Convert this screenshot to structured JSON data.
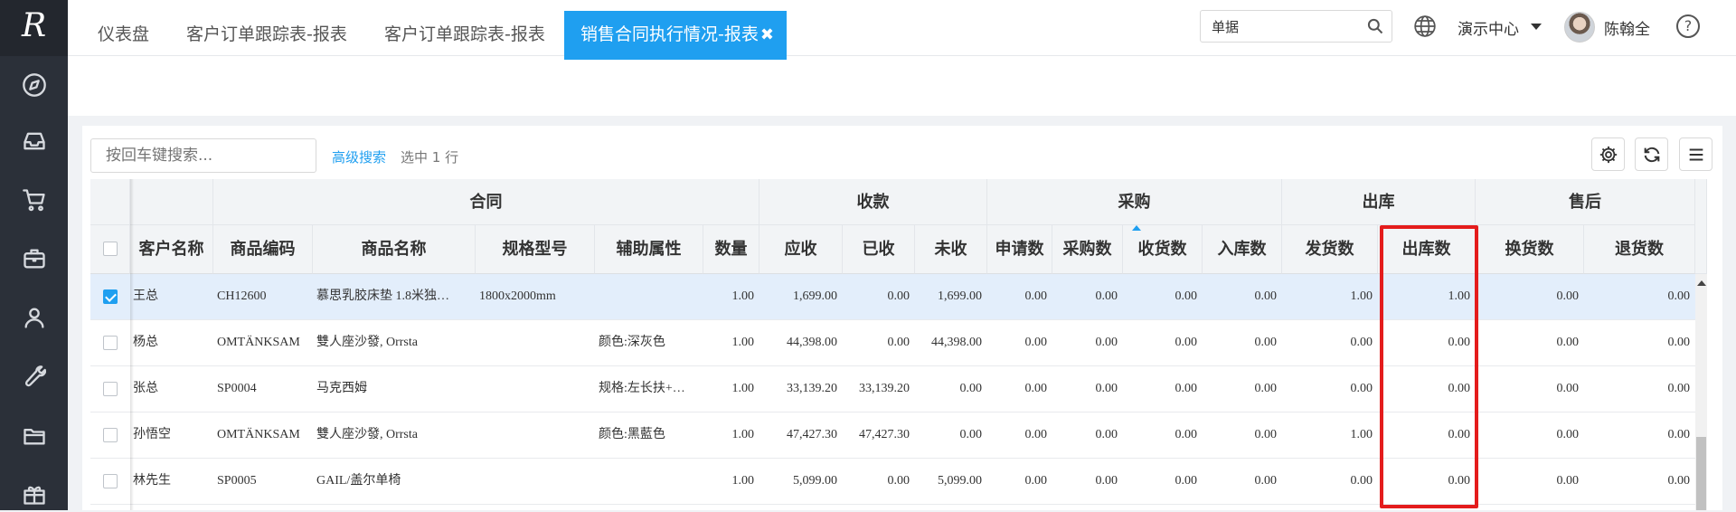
{
  "app": {
    "logo_text": "R"
  },
  "sidebar": {
    "icons": [
      "compass-icon",
      "inbox-icon",
      "cart-icon",
      "briefcase-icon",
      "user-icon",
      "wrench-icon",
      "folder-icon",
      "gift-icon"
    ]
  },
  "header": {
    "search_value": "单据",
    "org_label": "演示中心",
    "user_name": "陈翰全",
    "help_label": "?"
  },
  "tabs": [
    {
      "label": "仪表盘"
    },
    {
      "label": "客户订单跟踪表-报表"
    },
    {
      "label": "客户订单跟踪表-报表"
    },
    {
      "label": "销售合同执行情况-报表",
      "close": "✖",
      "active": true
    }
  ],
  "toolbar": {
    "search_placeholder": "按回车键搜索...",
    "advanced_search": "高级搜索",
    "selection_status": "选中 1 行"
  },
  "table": {
    "groups": [
      {
        "label": "合同"
      },
      {
        "label": "收款"
      },
      {
        "label": "采购"
      },
      {
        "label": "出库"
      },
      {
        "label": "售后"
      }
    ],
    "columns": [
      "客户名称",
      "商品编码",
      "商品名称",
      "规格型号",
      "辅助属性",
      "数量",
      "应收",
      "已收",
      "未收",
      "申请数",
      "采购数",
      "收货数",
      "入库数",
      "发货数",
      "出库数",
      "换货数",
      "退货数"
    ],
    "rows": [
      {
        "selected": true,
        "cells": [
          "王总",
          "CH12600",
          "慕思乳胶床垫 1.8米独…",
          "1800x2000mm",
          "",
          "1.00",
          "1,699.00",
          "0.00",
          "1,699.00",
          "0.00",
          "0.00",
          "0.00",
          "0.00",
          "1.00",
          "1.00",
          "0.00",
          "0.00"
        ]
      },
      {
        "selected": false,
        "cells": [
          "杨总",
          "OMTÄNKSAM",
          "雙人座沙發, Orrsta",
          "",
          "颜色:深灰色",
          "1.00",
          "44,398.00",
          "0.00",
          "44,398.00",
          "0.00",
          "0.00",
          "0.00",
          "0.00",
          "0.00",
          "0.00",
          "0.00",
          "0.00"
        ]
      },
      {
        "selected": false,
        "cells": [
          "张总",
          "SP0004",
          "马克西姆",
          "",
          "规格:左长扶+…",
          "1.00",
          "33,139.20",
          "33,139.20",
          "0.00",
          "0.00",
          "0.00",
          "0.00",
          "0.00",
          "0.00",
          "0.00",
          "0.00",
          "0.00"
        ]
      },
      {
        "selected": false,
        "cells": [
          "孙悟空",
          "OMTÄNKSAM",
          "雙人座沙發, Orrsta",
          "",
          "颜色:黑藍色",
          "1.00",
          "47,427.30",
          "47,427.30",
          "0.00",
          "0.00",
          "0.00",
          "0.00",
          "0.00",
          "1.00",
          "0.00",
          "0.00",
          "0.00"
        ]
      },
      {
        "selected": false,
        "cells": [
          "林先生",
          "SP0005",
          "GAIL/盖尔单椅",
          "",
          "",
          "1.00",
          "5,099.00",
          "0.00",
          "5,099.00",
          "0.00",
          "0.00",
          "0.00",
          "0.00",
          "0.00",
          "0.00",
          "0.00",
          "0.00"
        ]
      }
    ]
  },
  "colors": {
    "accent": "#1f9ff0",
    "highlight": "#e41c1c",
    "sidebar": "#2b3039"
  }
}
